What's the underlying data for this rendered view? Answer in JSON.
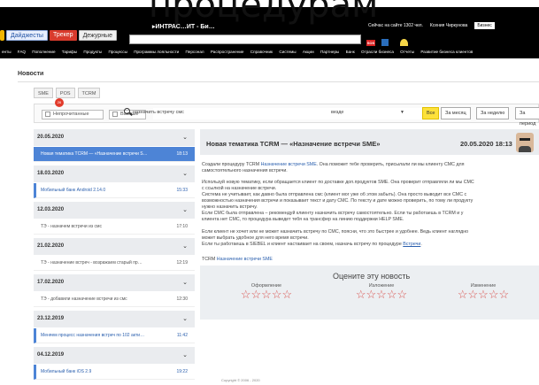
{
  "overlay_title": "процедурам",
  "topbar": {
    "buttons": [
      "Дайджесты",
      "Трекер",
      "Дежурные"
    ],
    "brand": "▸ИНТРАС…ИТ - Би…",
    "online": "Сейчас на сайте 1302 чел.",
    "user": "Ксения Чиркунова",
    "business_btn": "Бизнес",
    "sos": "SOS"
  },
  "menu": [
    "енты",
    "FAQ",
    "Пополнение",
    "Тарифы",
    "Продукты",
    "Процессы",
    "Программы лояльности",
    "Персонал",
    "Распространение",
    "Справочник",
    "Системы",
    "Акции",
    "Партнеры",
    "Банк",
    "Отрасли бизнеса",
    "Отчеты",
    "Развитие бизнеса клиентов"
  ],
  "page": {
    "heading": "Новости"
  },
  "tabs": [
    "SME",
    "POS",
    "TCRM"
  ],
  "filters": {
    "unread_label": "Непрочитанные",
    "unread_count": "26",
    "important_label": "Важные",
    "search_value": "назначить встречу смс",
    "where_value": "везде",
    "buttons": [
      "Все",
      "За месяц",
      "За неделю",
      "За период"
    ]
  },
  "list": [
    {
      "type": "date",
      "label": "20.05.2020"
    },
    {
      "type": "item",
      "label": "Новая тематика TCRM — «Назначение встречи S…",
      "time": "18:13",
      "state": "selected"
    },
    {
      "type": "date",
      "label": "18.03.2020"
    },
    {
      "type": "item",
      "label": "Мобильный банк Android 2.14.0",
      "time": "15:33",
      "state": "marked"
    },
    {
      "type": "date",
      "label": "12.03.2020"
    },
    {
      "type": "item",
      "label": "ТЭ - назначем встречи из смс",
      "time": "17:10",
      "state": ""
    },
    {
      "type": "date",
      "label": "21.02.2020"
    },
    {
      "type": "item",
      "label": "ТЭ - назначение встреч - возражаем старый пр…",
      "time": "12:19",
      "state": ""
    },
    {
      "type": "date",
      "label": "17.02.2020"
    },
    {
      "type": "item",
      "label": "ТЭ - добавили назначение встречи из смс",
      "time": "12:30",
      "state": ""
    },
    {
      "type": "date",
      "label": "23.12.2019"
    },
    {
      "type": "item",
      "label": "Меняем процесс назначения встреч по 102 акти…",
      "time": "11:42",
      "state": "marked"
    },
    {
      "type": "date",
      "label": "04.12.2019"
    },
    {
      "type": "item",
      "label": "Мобильный банк iOS 2.9",
      "time": "19:22",
      "state": "marked"
    }
  ],
  "article": {
    "title": "Новая тематика TCRM — «Назначение встречи SME»",
    "date": "20.05.2020 18:13",
    "p1a": "Создали процедуру TCRM ",
    "p1link": "Назначение встречи SME",
    "p1b": ". Она поможет тебе проверить, присылали ли мы клиенту СМС для",
    "p1c": "самостоятельного назначения встречи.",
    "p2": [
      "Используй новую тематику, если обращается клиент по доставке доп.продуктов SME. Она проверит отправляли ли мы СМС",
      "с ссылкой на назначение встречи.",
      "Система не учитывает, как давно была отправлена смс (клиент мог уже об этом забыть). Она просто выводит все СМС с",
      "возможностью назначения встречи и показывает текст и дату СМС. По тексту и дате можно проверить, по тому ли продукту",
      "нужно назначить встречу.",
      "Если СМС была отправлена – рекомендуй клиенту назначить встречу самостоятельно. Если ты работаешь в TCRM и у",
      "клиента нет СМС, то процедура выведет тебя на трансфер на линию поддержки HELP SME."
    ],
    "p3": [
      "Если клиент не хочет или не может назначить встречу по СМС, поясни, что это быстрее и удобнее. Ведь клиент наглядно",
      "может выбрать удобное для него время встречи."
    ],
    "p3c_a": "Если ты работаешь в SIEBEL и клиент настаивает на своем, назначь встречу по процедуре ",
    "p3c_link": "Встречи",
    "p3c_b": ".",
    "footer_prefix": "TCRM ",
    "footer_link": "Назначение встречи SME"
  },
  "rating": {
    "title": "Оцените эту новость",
    "cols": [
      {
        "label": "Оформление",
        "stars": "☆☆☆☆☆"
      },
      {
        "label": "Изложение",
        "stars": "☆☆☆☆☆"
      },
      {
        "label": "Изменение",
        "stars": "☆☆☆☆☆"
      }
    ]
  },
  "footer": "Copyright © 2006 - 2020"
}
